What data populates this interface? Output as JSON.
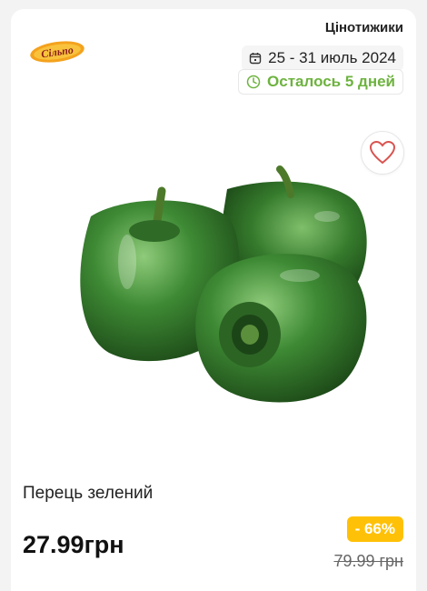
{
  "brand": {
    "logo_text": "Сільпо"
  },
  "promo": {
    "label": "Цінотижики",
    "dates": "25 - 31 июль 2024",
    "remaining": "Осталось 5 дней"
  },
  "product": {
    "name": "Перець зелений",
    "price": "27.99грн",
    "discount": "- 66%",
    "old_price": "79.99 грн",
    "image": "green-bell-peppers"
  },
  "icons": {
    "calendar": "calendar-icon",
    "clock": "clock-icon",
    "favorite": "heart-icon"
  },
  "colors": {
    "accent_green": "#6db33f",
    "discount_badge": "#ffc107",
    "heart": "#d9534f"
  }
}
